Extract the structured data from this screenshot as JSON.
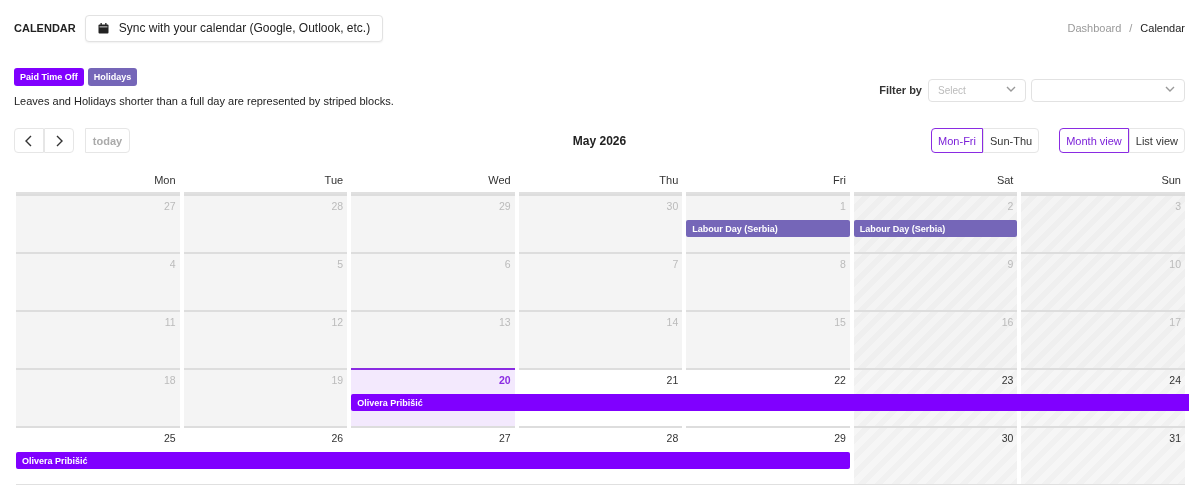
{
  "page_title": "CALENDAR",
  "sync_button": {
    "label": "Sync with your calendar (Google, Outlook, etc.)"
  },
  "breadcrumb": {
    "separator": "/",
    "items": [
      {
        "label": "Dashboard",
        "current": false
      },
      {
        "label": "Calendar",
        "current": true
      }
    ]
  },
  "legend": [
    {
      "label": "Paid Time Off",
      "color": "#8000ff"
    },
    {
      "label": "Holidays",
      "color": "#7566b8"
    }
  ],
  "note": "Leaves and Holidays shorter than a full day are represented by striped blocks.",
  "filter": {
    "label": "Filter by",
    "fields": [
      {
        "kind": "select",
        "placeholder": "Select"
      },
      {
        "kind": "select"
      }
    ]
  },
  "toolbar": {
    "today": {
      "label": "today",
      "disabled": true
    },
    "title": "May 2026",
    "week_options": [
      {
        "label": "Mon-Fri",
        "selected": true
      },
      {
        "label": "Sun-Thu",
        "selected": false
      }
    ],
    "views": [
      {
        "label": "Month view",
        "selected": true
      },
      {
        "label": "List view",
        "selected": false
      }
    ]
  },
  "calendar": {
    "weekdays": [
      "Mon",
      "Tue",
      "Wed",
      "Thu",
      "Fri",
      "Sat",
      "Sun"
    ],
    "weeks": [
      {
        "days": [
          {
            "number": "27",
            "kind": "past"
          },
          {
            "number": "28",
            "kind": "past"
          },
          {
            "number": "29",
            "kind": "past"
          },
          {
            "number": "30",
            "kind": "past"
          },
          {
            "number": "1",
            "kind": "past",
            "event": {
              "label": "Labour Day (Serbia)",
              "color": "#7566b8",
              "continued": false
            }
          },
          {
            "number": "2",
            "kind": "past_weekend",
            "event": {
              "label": "Labour Day (Serbia)",
              "color": "#7566b8",
              "continued": false
            }
          },
          {
            "number": "3",
            "kind": "past_weekend"
          }
        ]
      },
      {
        "days": [
          {
            "number": "4",
            "kind": "past"
          },
          {
            "number": "5",
            "kind": "past"
          },
          {
            "number": "6",
            "kind": "past"
          },
          {
            "number": "7",
            "kind": "past"
          },
          {
            "number": "8",
            "kind": "past"
          },
          {
            "number": "9",
            "kind": "past_weekend"
          },
          {
            "number": "10",
            "kind": "past_weekend"
          }
        ]
      },
      {
        "days": [
          {
            "number": "11",
            "kind": "past"
          },
          {
            "number": "12",
            "kind": "past"
          },
          {
            "number": "13",
            "kind": "past"
          },
          {
            "number": "14",
            "kind": "past"
          },
          {
            "number": "15",
            "kind": "past"
          },
          {
            "number": "16",
            "kind": "past_weekend"
          },
          {
            "number": "17",
            "kind": "past_weekend"
          }
        ]
      },
      {
        "days": [
          {
            "number": "18",
            "kind": "past"
          },
          {
            "number": "19",
            "kind": "past"
          },
          {
            "number": "20",
            "kind": "today",
            "event": {
              "label": "Olivera Pribišić",
              "color": "#8000ff",
              "continued": false
            }
          },
          {
            "number": "21",
            "kind": "future",
            "event": {
              "color": "#8000ff",
              "continued": true
            }
          },
          {
            "number": "22",
            "kind": "future",
            "event": {
              "color": "#8000ff",
              "continued": true
            }
          },
          {
            "number": "23",
            "kind": "future_weekend",
            "event": {
              "color": "#8000ff",
              "continued": true
            }
          },
          {
            "number": "24",
            "kind": "future_weekend",
            "event": {
              "color": "#8000ff",
              "continued": true
            }
          }
        ]
      },
      {
        "days": [
          {
            "number": "25",
            "kind": "future",
            "event": {
              "label": "Olivera Pribišić",
              "color": "#8000ff",
              "continued": false
            }
          },
          {
            "number": "26",
            "kind": "future",
            "event": {
              "color": "#8000ff",
              "continued": true
            }
          },
          {
            "number": "27",
            "kind": "future",
            "event": {
              "color": "#8000ff",
              "continued": true
            }
          },
          {
            "number": "28",
            "kind": "future",
            "event": {
              "color": "#8000ff",
              "continued": true
            }
          },
          {
            "number": "29",
            "kind": "future",
            "event": {
              "color": "#8000ff",
              "continued": true
            }
          },
          {
            "number": "30",
            "kind": "future_weekend"
          },
          {
            "number": "31",
            "kind": "future_weekend"
          }
        ]
      }
    ]
  }
}
